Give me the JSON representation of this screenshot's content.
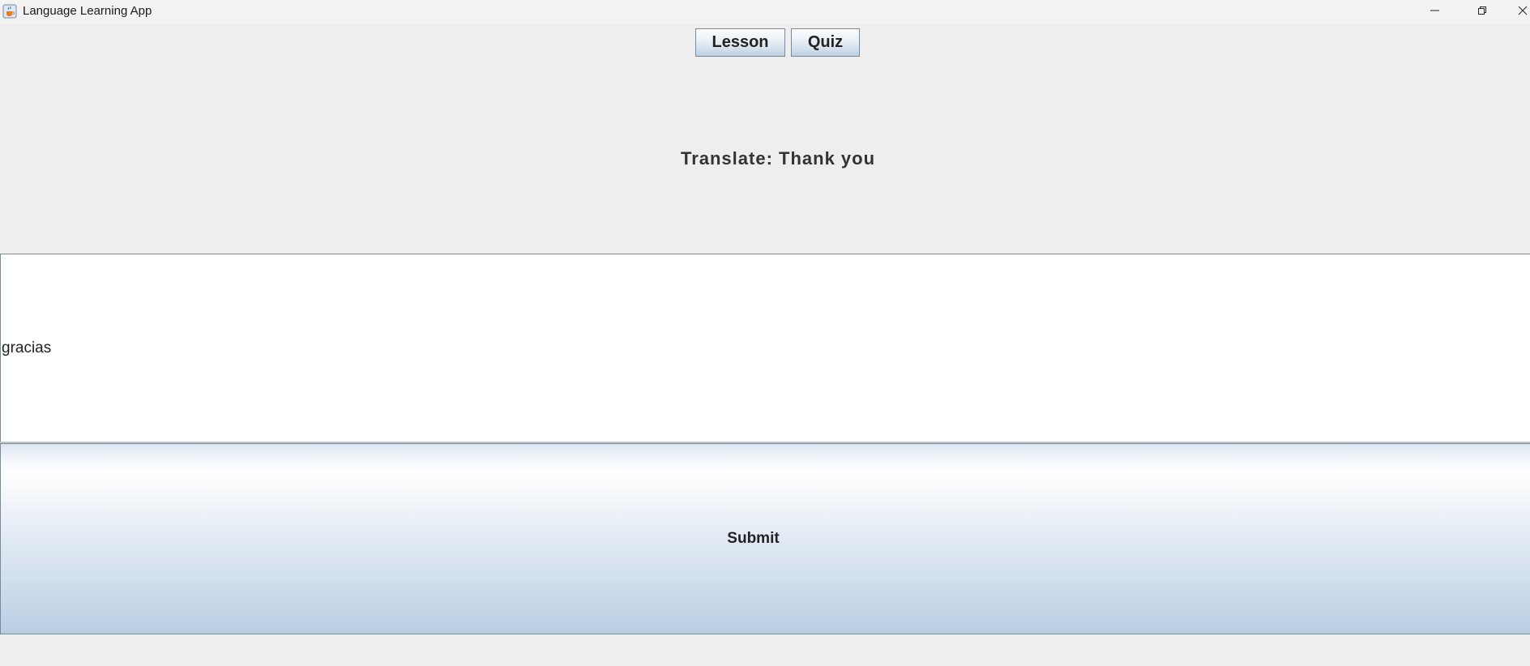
{
  "window": {
    "title": "Language Learning App",
    "icon": "java-cup-icon",
    "controls": [
      "minimize-icon",
      "restore-icon",
      "close-icon"
    ]
  },
  "tabs": [
    {
      "label": "Lesson"
    },
    {
      "label": "Quiz"
    }
  ],
  "quiz": {
    "prompt": "Translate: Thank you",
    "answer_value": "gracias",
    "submit_label": "Submit"
  },
  "colors": {
    "window_bg": "#eeeeee",
    "titlebar_bg": "#f3f3f3",
    "button_border": "#7a8a99",
    "button_gradient_bottom": "#bccfe3"
  }
}
